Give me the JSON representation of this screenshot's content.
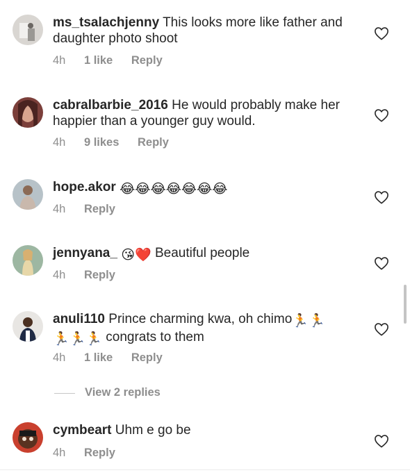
{
  "colors": {
    "text": "#262626",
    "muted": "#8e8e8e",
    "heart_emoji": "#e0245e"
  },
  "comments": [
    {
      "username": "ms_tsalachjenny",
      "text": "This looks more like father and daughter photo shoot",
      "time": "4h",
      "likes": "1 like",
      "reply": "Reply",
      "avatar_icon": "avatar-photo"
    },
    {
      "username": "cabralbarbie_2016",
      "text": "He would probably make her happier than a younger guy would.",
      "time": "4h",
      "likes": "9 likes",
      "reply": "Reply",
      "avatar_icon": "avatar-photo"
    },
    {
      "username": "hope.akor",
      "text": "😂😂😂😂😂😂😂",
      "time": "4h",
      "reply": "Reply",
      "avatar_icon": "avatar-photo"
    },
    {
      "username": "jennyana_",
      "emojis": "😘❤️",
      "text": "Beautiful people",
      "time": "4h",
      "reply": "Reply",
      "avatar_icon": "avatar-photo"
    },
    {
      "username": "anuli110",
      "text_before": "Prince charming kwa, oh chimo",
      "emojis_a": "🏃🏃",
      "emojis_b": "🏃🏃🏃",
      "text_after": "congrats to them",
      "time": "4h",
      "likes": "1 like",
      "reply": "Reply",
      "avatar_icon": "avatar-photo"
    },
    {
      "username": "cymbeart",
      "text": "Uhm e go be",
      "time": "4h",
      "reply": "Reply",
      "avatar_icon": "avatar-photo"
    }
  ],
  "view_replies": "View 2 replies",
  "icons": {
    "like": "heart-outline-icon"
  }
}
